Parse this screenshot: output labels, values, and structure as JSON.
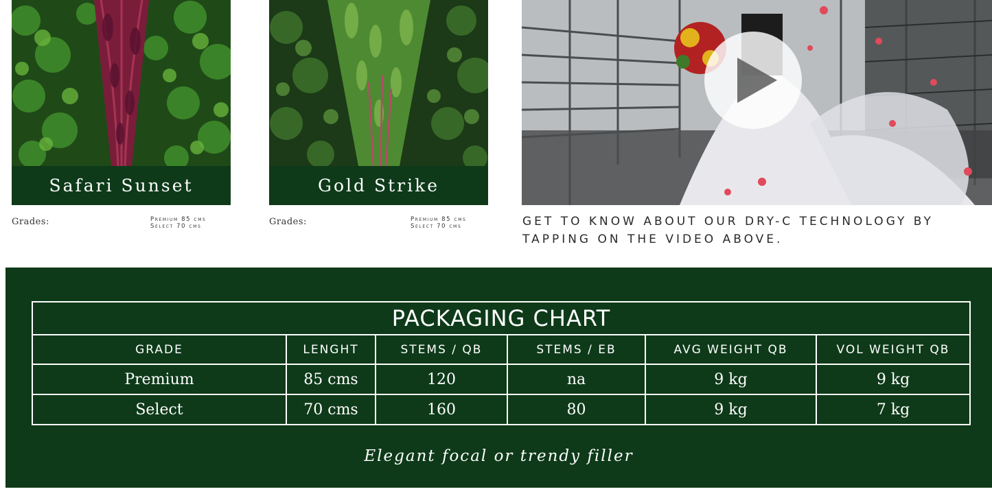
{
  "products": [
    {
      "name": "Safari Sunset",
      "grades_label": "Grades:",
      "grades": [
        "Premium 85 cms",
        "Select 70 cms"
      ]
    },
    {
      "name": "Gold Strike",
      "grades_label": "Grades:",
      "grades": [
        "Premium 85 cms",
        "Select 70 cms"
      ]
    }
  ],
  "video": {
    "caption": "Get to know about our Dry-C technology by tapping on the video above.",
    "play_icon": "play-icon"
  },
  "packaging_chart": {
    "title": "PACKAGING CHART",
    "columns": [
      "GRADE",
      "LENGHT",
      "STEMS / QB",
      "STEMS / EB",
      "AVG WEIGHT QB",
      "VOL WEIGHT QB"
    ],
    "rows": [
      [
        "Premium",
        "85 cms",
        "120",
        "na",
        "9 kg",
        "9 kg"
      ],
      [
        "Select",
        "70 cms",
        "160",
        "80",
        "9 kg",
        "7 kg"
      ]
    ],
    "tagline": "Elegant focal or trendy filler"
  },
  "colors": {
    "brand_green": "#0e3a19",
    "text_dark": "#333333",
    "white": "#ffffff"
  }
}
